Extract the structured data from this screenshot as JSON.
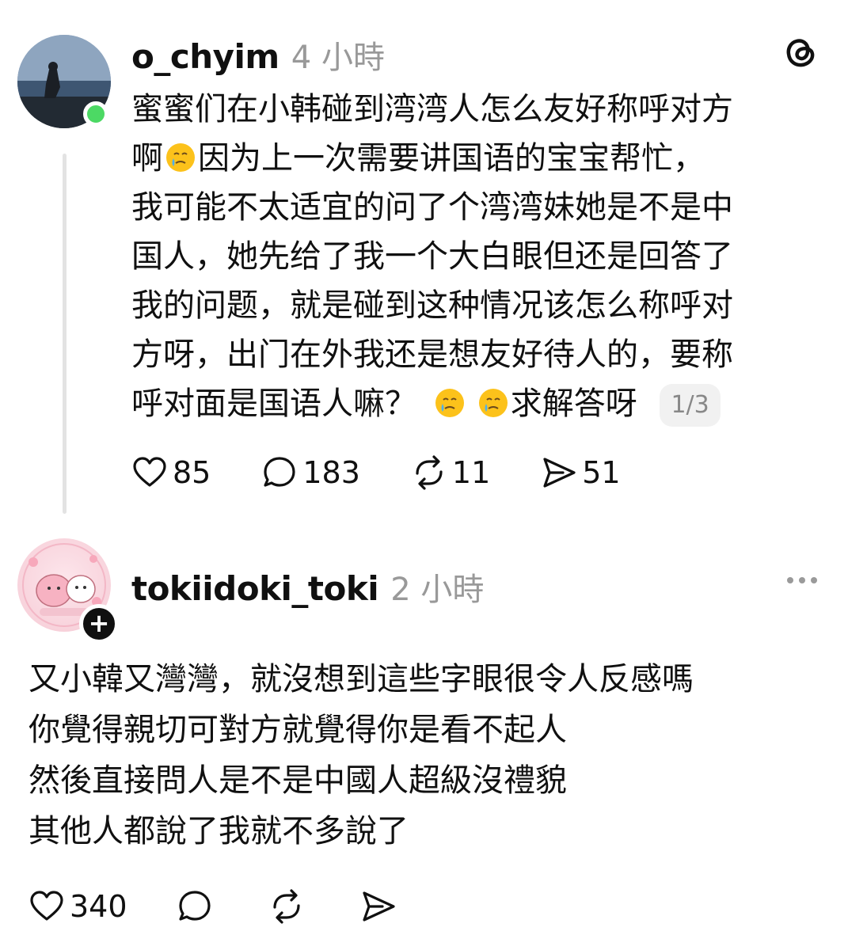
{
  "posts": [
    {
      "username": "o_chyim",
      "time": "4 小時",
      "lines": [
        "蜜蜜们在小韩碰到湾湾人怎么友好称呼对方",
        "啊",
        "因为上一次需要讲国语的宝宝帮忙，",
        "我可能不太适宜的问了个湾湾妹她是不是中",
        "国人，她先给了我一个大白眼但还是回答了",
        "我的问题，就是碰到这种情况该怎么称呼对",
        "方呀，出门在外我还是想友好待人的，要称",
        "呼对面是国语人嘛？",
        "求解答呀"
      ],
      "page_indicator": "1/3",
      "likes": "85",
      "comments": "183",
      "reposts": "11",
      "shares": "51",
      "app_icon": "threads-logo-icon",
      "status_color": "#4cd964"
    },
    {
      "username": "tokiidoki_toki",
      "time": "2 小時",
      "lines": [
        "又小韓又灣灣，就沒想到這些字眼很令人反感嗎",
        "你覺得親切可對方就覺得你是看不起人",
        "然後直接問人是不是中國人超級沒禮貌",
        "其他人都說了我就不多說了"
      ],
      "likes": "340",
      "more_icon": "more-dots-icon",
      "follow_badge": "+"
    }
  ]
}
